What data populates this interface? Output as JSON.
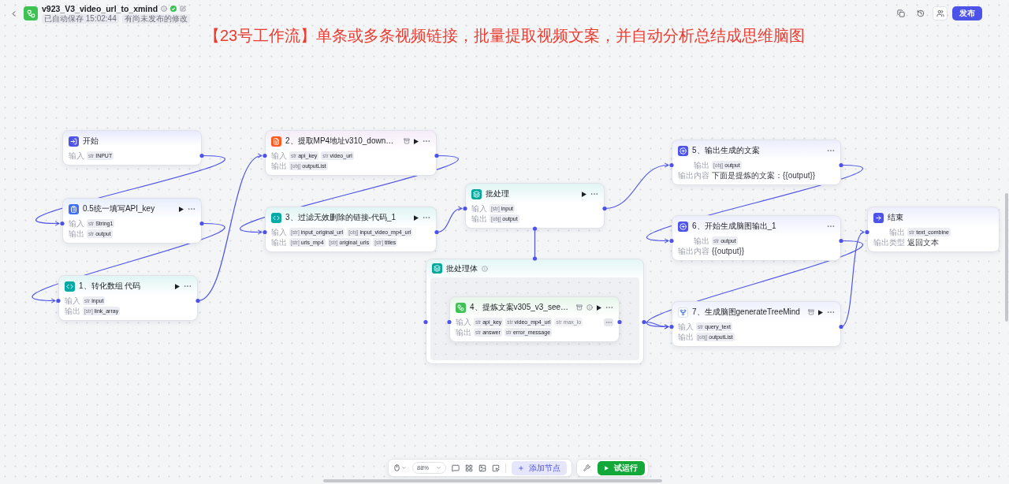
{
  "header": {
    "title": "v923_V3_video_url_to_xmind",
    "badges": [
      "已自动保存 15:02:44",
      "有尚未发布的修改"
    ],
    "publish_button": "发布"
  },
  "banner": "【23号工作流】单条或多条视频链接，批量提取视频文案，并自动分析总结成思维脑图",
  "nodes": [
    {
      "kind": "start",
      "title": "开始",
      "rows": [
        {
          "label": "输入",
          "overflow": false,
          "tags": [
            {
              "type": "str",
              "name": "INPUT"
            }
          ]
        }
      ]
    },
    {
      "kind": "variable",
      "title": "0.5统一填写API_key",
      "rows": [
        {
          "label": "输入",
          "overflow": false,
          "tags": [
            {
              "type": "str",
              "name": "String1"
            }
          ]
        },
        {
          "label": "输出",
          "overflow": false,
          "tags": [
            {
              "type": "str",
              "name": "output"
            }
          ]
        }
      ]
    },
    {
      "kind": "code",
      "title": "1、转化数组 代码",
      "rows": [
        {
          "label": "输入",
          "overflow": false,
          "tags": [
            {
              "type": "str",
              "name": "input"
            }
          ]
        },
        {
          "label": "输出",
          "overflow": false,
          "tags": [
            {
              "type": "[str]",
              "name": "link_array"
            }
          ]
        }
      ]
    },
    {
      "kind": "plugin",
      "title": "2、提取MP4地址v310_down…",
      "rows": [
        {
          "label": "输入",
          "overflow": false,
          "tags": [
            {
              "type": "str",
              "name": "api_key"
            },
            {
              "type": "str",
              "name": "video_url"
            }
          ]
        },
        {
          "label": "输出",
          "overflow": false,
          "tags": [
            {
              "type": "[obj]",
              "name": "outputList"
            }
          ]
        }
      ]
    },
    {
      "kind": "code",
      "title": "3、过滤无效删除的链接-代码_1",
      "rows": [
        {
          "label": "输入",
          "overflow": false,
          "tags": [
            {
              "type": "[str]",
              "name": "input_original_url"
            },
            {
              "type": "[obj]",
              "name": "input_video_mp4_url"
            }
          ]
        },
        {
          "label": "输出",
          "overflow": false,
          "tags": [
            {
              "type": "[str]",
              "name": "urls_mp4"
            },
            {
              "type": "[str]",
              "name": "original_urls"
            },
            {
              "type": "[str]",
              "name": "titles"
            }
          ]
        }
      ]
    },
    {
      "kind": "batch",
      "title": "批处理",
      "rows": [
        {
          "label": "输入",
          "overflow": false,
          "tags": [
            {
              "type": "[str]",
              "name": "input"
            }
          ]
        },
        {
          "label": "输出",
          "overflow": false,
          "tags": [
            {
              "type": "[obj]",
              "name": "output"
            }
          ]
        }
      ]
    },
    {
      "kind": "message",
      "title": "5、输出生成的文案",
      "rows": [
        {
          "label": "输出",
          "overflow": false,
          "tags": [
            {
              "type": "[obj]",
              "name": "output"
            }
          ]
        },
        {
          "label": "输出内容",
          "overflow": false,
          "text": "下面是提炼的文案：{{output}}"
        }
      ]
    },
    {
      "kind": "message",
      "title": "6、开始生成脑图输出_1",
      "rows": [
        {
          "label": "输出",
          "overflow": false,
          "tags": [
            {
              "type": "str",
              "name": "output"
            }
          ]
        },
        {
          "label": "输出内容",
          "overflow": false,
          "text": "{{output}}"
        }
      ]
    },
    {
      "kind": "tool",
      "title": "7、生成脑图generateTreeMind",
      "rows": [
        {
          "label": "输入",
          "overflow": false,
          "tags": [
            {
              "type": "str",
              "name": "query_text"
            }
          ]
        },
        {
          "label": "输出",
          "overflow": false,
          "tags": [
            {
              "type": "[obj]",
              "name": "outputList"
            }
          ]
        }
      ]
    },
    {
      "kind": "end",
      "title": "结束",
      "rows": [
        {
          "label": "输出",
          "overflow": false,
          "tags": [
            {
              "type": "str",
              "name": "text_combine"
            }
          ]
        },
        {
          "label": "输出类型",
          "overflow": false,
          "text": "返回文本"
        }
      ]
    }
  ],
  "batch_body": {
    "title": "批处理体",
    "nodes": [
      {
        "kind": "workflow",
        "title": "4、提炼文案v305_v3_see…",
        "rows": [
          {
            "label": "输入",
            "overflow": true,
            "tags": [
              {
                "type": "str",
                "name": "api_key"
              },
              {
                "type": "str",
                "name": "video_mp4_url"
              },
              {
                "type": "str",
                "name": "max_lo"
              }
            ]
          },
          {
            "label": "输出",
            "overflow": false,
            "tags": [
              {
                "type": "str",
                "name": "answer"
              },
              {
                "type": "str",
                "name": "error_message"
              }
            ]
          }
        ]
      }
    ]
  },
  "toolbar": {
    "zoom": "88%",
    "add_node_button": "添加节点",
    "test_run_button": "试运行"
  }
}
